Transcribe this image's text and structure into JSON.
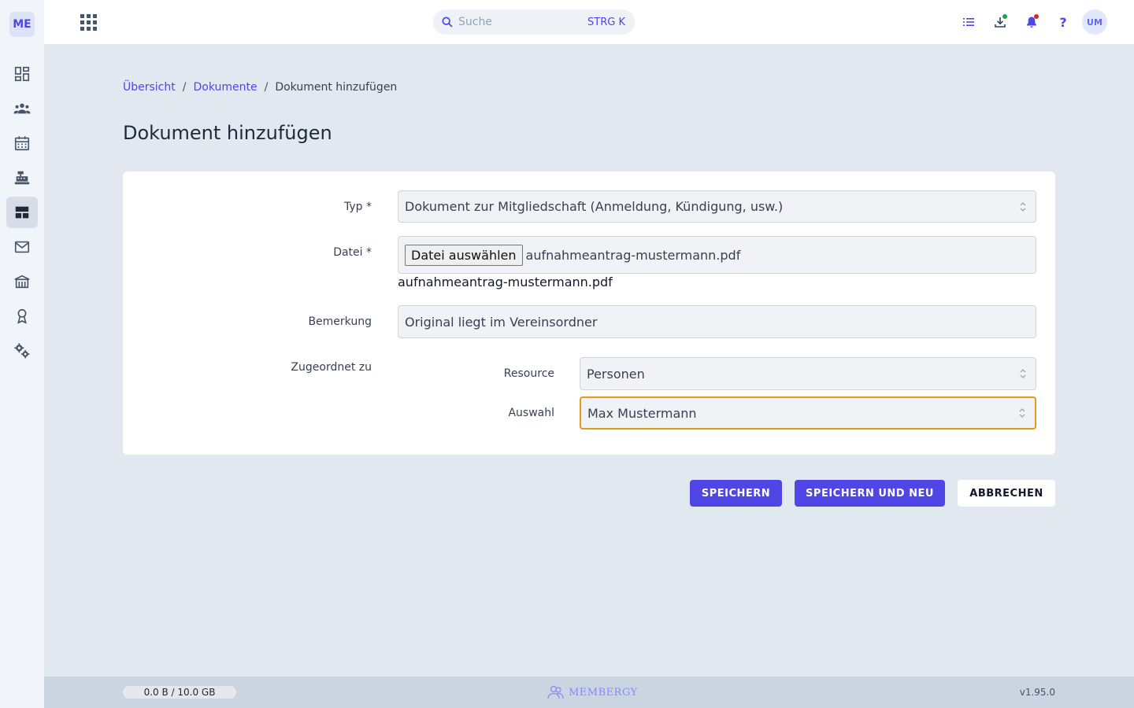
{
  "app": {
    "logo": "ME"
  },
  "sidebar": {
    "items": [
      {
        "icon": "dashboard-icon"
      },
      {
        "icon": "members-icon"
      },
      {
        "icon": "calendar-icon"
      },
      {
        "icon": "cash-register-icon"
      },
      {
        "icon": "documents-icon",
        "active": true
      },
      {
        "icon": "mail-icon"
      },
      {
        "icon": "facility-icon"
      },
      {
        "icon": "award-icon"
      },
      {
        "icon": "settings-icon"
      }
    ]
  },
  "topbar": {
    "search_placeholder": "Suche",
    "search_shortcut": "STRG K",
    "help": "?",
    "avatar": "UM",
    "download_status_color": "#16a34a",
    "notification_status_color": "#dc2626"
  },
  "breadcrumb": {
    "items": [
      "Übersicht",
      "Dokumente"
    ],
    "separator": "/",
    "current": "Dokument hinzufügen"
  },
  "page": {
    "title": "Dokument hinzufügen"
  },
  "form": {
    "type": {
      "label": "Typ *",
      "value": "Dokument zur Mitgliedschaft (Anmeldung, Kündigung, usw.)"
    },
    "file": {
      "label": "Datei *",
      "button": "Datei auswählen",
      "selected": "aufnahmeantrag-mustermann.pdf",
      "caption": "aufnahmeantrag-mustermann.pdf"
    },
    "remark": {
      "label": "Bemerkung",
      "value": "Original liegt im Vereinsordner"
    },
    "assigned": {
      "label": "Zugeordnet zu",
      "resource": {
        "label": "Resource",
        "value": "Personen"
      },
      "selection": {
        "label": "Auswahl",
        "value": "Max Mustermann"
      }
    }
  },
  "actions": {
    "save": "SPEICHERN",
    "save_new": "SPEICHERN UND NEU",
    "cancel": "ABBRECHEN"
  },
  "footer": {
    "storage": "0.0 B / 10.0 GB",
    "brand": "MEMBERGY",
    "version": "v1.95.0"
  },
  "colors": {
    "accent": "#4f46e5",
    "focus": "#e29a1a"
  }
}
